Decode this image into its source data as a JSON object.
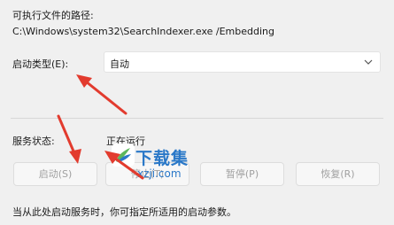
{
  "executable_path": {
    "label": "可执行文件的路径:",
    "value": "C:\\Windows\\system32\\SearchIndexer.exe /Embedding"
  },
  "startup_type": {
    "label": "启动类型(E):",
    "selected": "自动"
  },
  "service_status": {
    "label": "服务状态:",
    "value": "正在运行"
  },
  "buttons": {
    "start": "启动(S)",
    "stop": "停止(T)",
    "pause": "暂停(P)",
    "resume": "恢复(R)"
  },
  "hint": "当从此处启动服务时，你可指定所适用的启动参数。",
  "watermark": {
    "title": "下载集",
    "domain": "xzji.com"
  },
  "colors": {
    "annotation_arrow": "#e23b2e",
    "watermark_blue": "#2a78c8"
  }
}
